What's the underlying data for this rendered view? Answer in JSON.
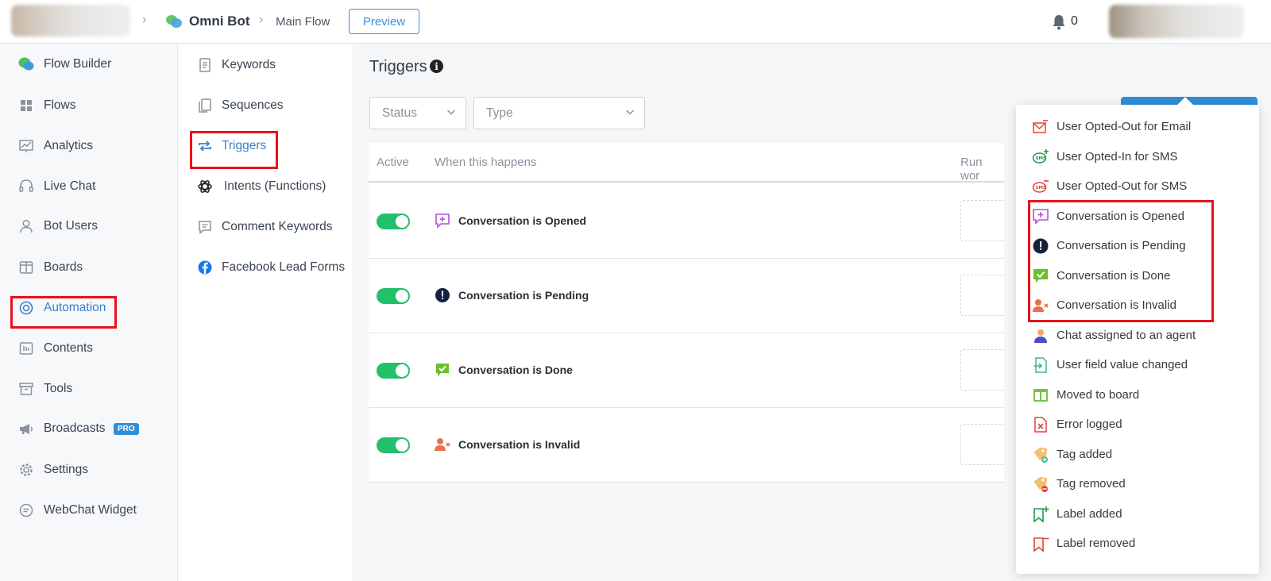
{
  "header": {
    "bot_name": "Omni Bot",
    "flow_name": "Main Flow",
    "preview_label": "Preview",
    "notification_count": "0"
  },
  "sidebar": {
    "items": [
      {
        "label": "Flow Builder",
        "icon": "chat-bubbles-icon"
      },
      {
        "label": "Flows",
        "icon": "grid-icon"
      },
      {
        "label": "Analytics",
        "icon": "chart-icon"
      },
      {
        "label": "Live Chat",
        "icon": "headset-icon"
      },
      {
        "label": "Bot Users",
        "icon": "user-icon"
      },
      {
        "label": "Boards",
        "icon": "board-icon"
      },
      {
        "label": "Automation",
        "icon": "lifebuoy-icon"
      },
      {
        "label": "Contents",
        "icon": "contents-icon"
      },
      {
        "label": "Tools",
        "icon": "archive-icon"
      },
      {
        "label": "Broadcasts",
        "icon": "megaphone-icon"
      },
      {
        "label": "Settings",
        "icon": "gear-icon"
      },
      {
        "label": "WebChat Widget",
        "icon": "chat-icon"
      }
    ],
    "pro_badge": "PRO"
  },
  "subnav": {
    "items": [
      {
        "label": "Keywords"
      },
      {
        "label": "Sequences"
      },
      {
        "label": "Triggers"
      },
      {
        "label": "Intents (Functions)"
      },
      {
        "label": "Comment Keywords"
      },
      {
        "label": "Facebook Lead Forms"
      }
    ]
  },
  "main": {
    "title": "Triggers",
    "filters": {
      "status_placeholder": "Status",
      "type_placeholder": "Type"
    },
    "columns": {
      "active": "Active",
      "event": "When this happens",
      "run": "Run wor"
    },
    "rows": [
      {
        "event": "Conversation is Opened"
      },
      {
        "event": "Conversation is Pending"
      },
      {
        "event": "Conversation is Done"
      },
      {
        "event": "Conversation is Invalid"
      }
    ]
  },
  "dropdown": {
    "items": [
      {
        "label": "User Opted-Out for Email"
      },
      {
        "label": "User Opted-In for SMS"
      },
      {
        "label": "User Opted-Out for SMS"
      },
      {
        "label": "Conversation is Opened"
      },
      {
        "label": "Conversation is Pending"
      },
      {
        "label": "Conversation is Done"
      },
      {
        "label": "Conversation is Invalid"
      },
      {
        "label": "Chat assigned to an agent"
      },
      {
        "label": "User field value changed"
      },
      {
        "label": "Moved to board"
      },
      {
        "label": "Error logged"
      },
      {
        "label": "Tag added"
      },
      {
        "label": "Tag removed"
      },
      {
        "label": "Label added"
      },
      {
        "label": "Label removed"
      }
    ]
  },
  "colors": {
    "accent": "#3a7fd0",
    "toggle_on": "#22c06a",
    "highlight": "#e8121b"
  }
}
